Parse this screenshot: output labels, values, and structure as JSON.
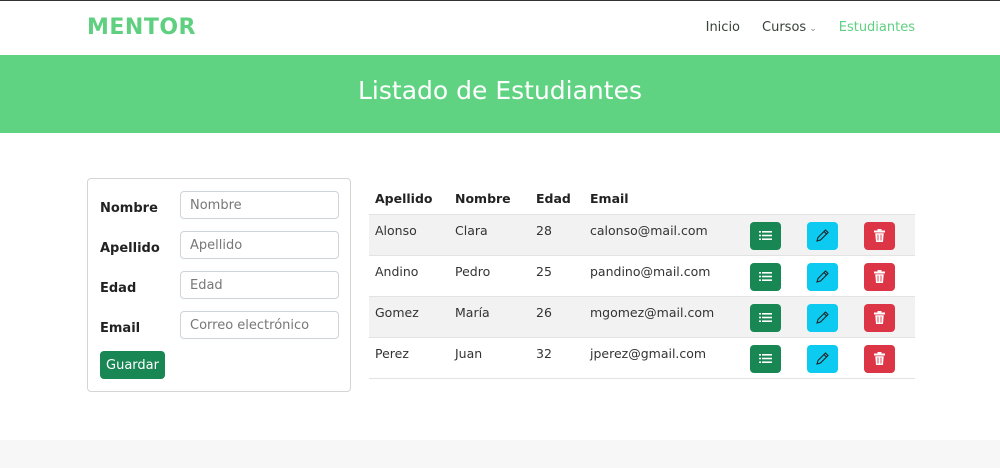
{
  "header": {
    "logo": "MENTOR",
    "nav": [
      {
        "label": "Inicio"
      },
      {
        "label": "Cursos"
      },
      {
        "label": "Estudiantes"
      }
    ]
  },
  "banner": {
    "title": "Listado de Estudiantes"
  },
  "form": {
    "nombre_label": "Nombre",
    "nombre_placeholder": "Nombre",
    "apellido_label": "Apellido",
    "apellido_placeholder": "Apellido",
    "edad_label": "Edad",
    "edad_placeholder": "Edad",
    "email_label": "Email",
    "email_placeholder": "Correo electrónico",
    "save_label": "Guardar"
  },
  "table": {
    "headers": [
      "Apellido",
      "Nombre",
      "Edad",
      "Email"
    ],
    "rows": [
      {
        "apellido": "Alonso",
        "nombre": "Clara",
        "edad": "28",
        "email": "calonso@mail.com"
      },
      {
        "apellido": "Andino",
        "nombre": "Pedro",
        "edad": "25",
        "email": "pandino@mail.com"
      },
      {
        "apellido": "Gomez",
        "nombre": "María",
        "edad": "26",
        "email": "mgomez@mail.com"
      },
      {
        "apellido": "Perez",
        "nombre": "Juan",
        "edad": "32",
        "email": "jperez@gmail.com"
      }
    ],
    "actions": {
      "list_icon": "list-icon",
      "edit_icon": "pencil-icon",
      "delete_icon": "trash-icon"
    }
  },
  "colors": {
    "brand": "#5fcf80",
    "banner": "#5fd381",
    "success": "#198754",
    "info": "#0dcaf0",
    "danger": "#dc3545"
  }
}
